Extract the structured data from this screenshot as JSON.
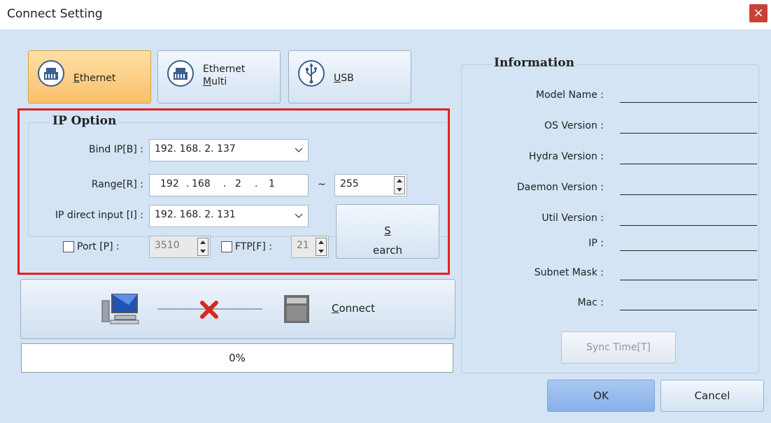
{
  "window": {
    "title": "Connect Setting",
    "close_glyph": "×"
  },
  "connection_types": [
    {
      "accel": "E",
      "rest": "thernet",
      "active": true
    },
    {
      "line1": "Ethernet",
      "accel": "M",
      "rest": "ulti",
      "active": false
    },
    {
      "accel": "U",
      "rest": "SB",
      "active": false
    }
  ],
  "ip_option": {
    "title": "IP Option",
    "bind_ip_label": "Bind IP[B] :",
    "bind_ip_value": "192. 168. 2. 137",
    "range_label": "Range[R] :",
    "range_octets": [
      "192",
      "168",
      "2",
      "1"
    ],
    "range_separator": "~",
    "range_end": "255",
    "direct_input_label": "IP direct input [I] :",
    "direct_input_value": "192. 168. 2. 131",
    "port_label": "Port  [P] :",
    "port_value": "3510",
    "ftp_label": "FTP[F] :",
    "ftp_value": "21",
    "search_accel": "S",
    "search_rest": "earch"
  },
  "connect": {
    "accel": "C",
    "rest": "onnect",
    "status": "disconnected"
  },
  "progress": {
    "percent_text": "0%",
    "value": 0
  },
  "information": {
    "title": "Information",
    "labels": [
      "Model Name :",
      "OS Version :",
      "Hydra Version :",
      "Daemon Version :",
      "Util Version :",
      "IP :",
      "Subnet Mask :",
      "Mac :"
    ],
    "sync_time_label": "Sync Time[T]"
  },
  "buttons": {
    "ok": "OK",
    "cancel": "Cancel"
  },
  "colors": {
    "accent_active": "#f9bf6b",
    "panel_bg": "#d4e4f5",
    "close_bg": "#c8423a",
    "highlight_red": "#e02020"
  }
}
